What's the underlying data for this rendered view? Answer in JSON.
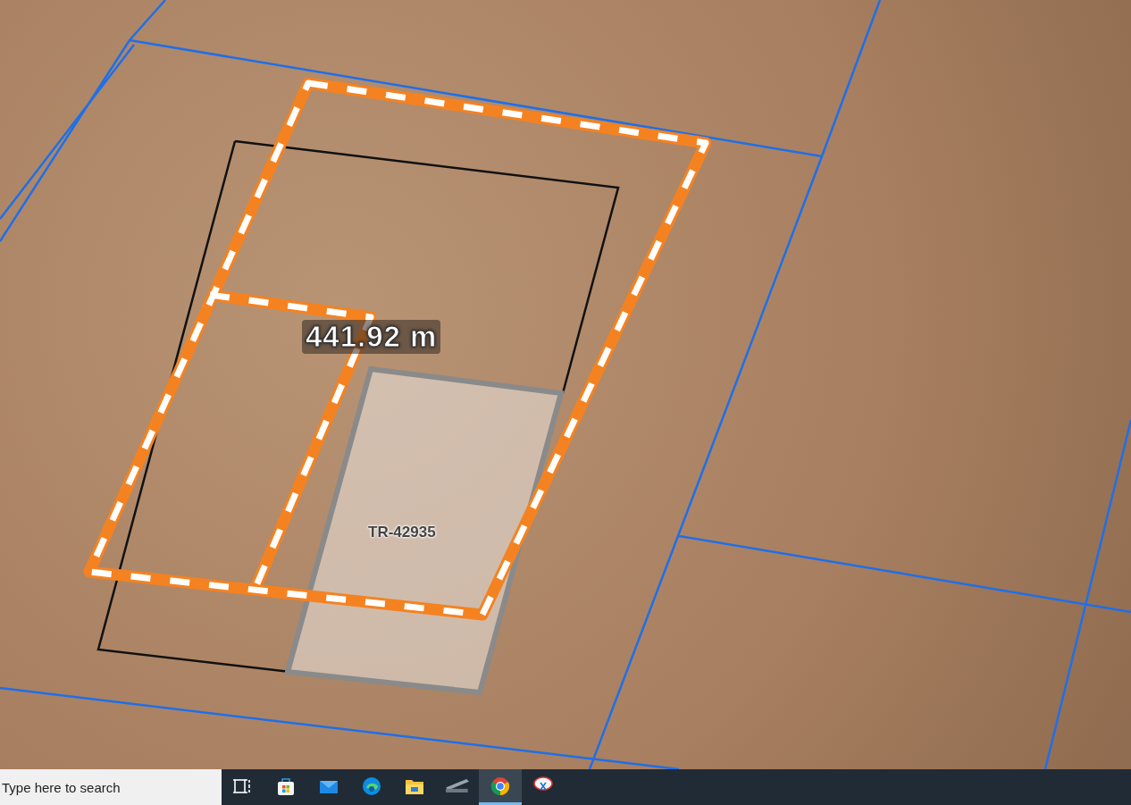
{
  "map": {
    "measurement_label": "441.92 m",
    "parcel_label": "TR-42935"
  },
  "taskbar": {
    "search": {
      "placeholder": "Type here to search"
    },
    "apps": [
      {
        "kind": "taskview",
        "selected": false
      },
      {
        "kind": "store",
        "selected": false
      },
      {
        "kind": "mail",
        "selected": false
      },
      {
        "kind": "edge",
        "selected": false
      },
      {
        "kind": "explorer",
        "selected": false
      },
      {
        "kind": "scanner",
        "selected": false
      },
      {
        "kind": "chrome",
        "selected": true
      },
      {
        "kind": "snip",
        "selected": false
      }
    ]
  }
}
